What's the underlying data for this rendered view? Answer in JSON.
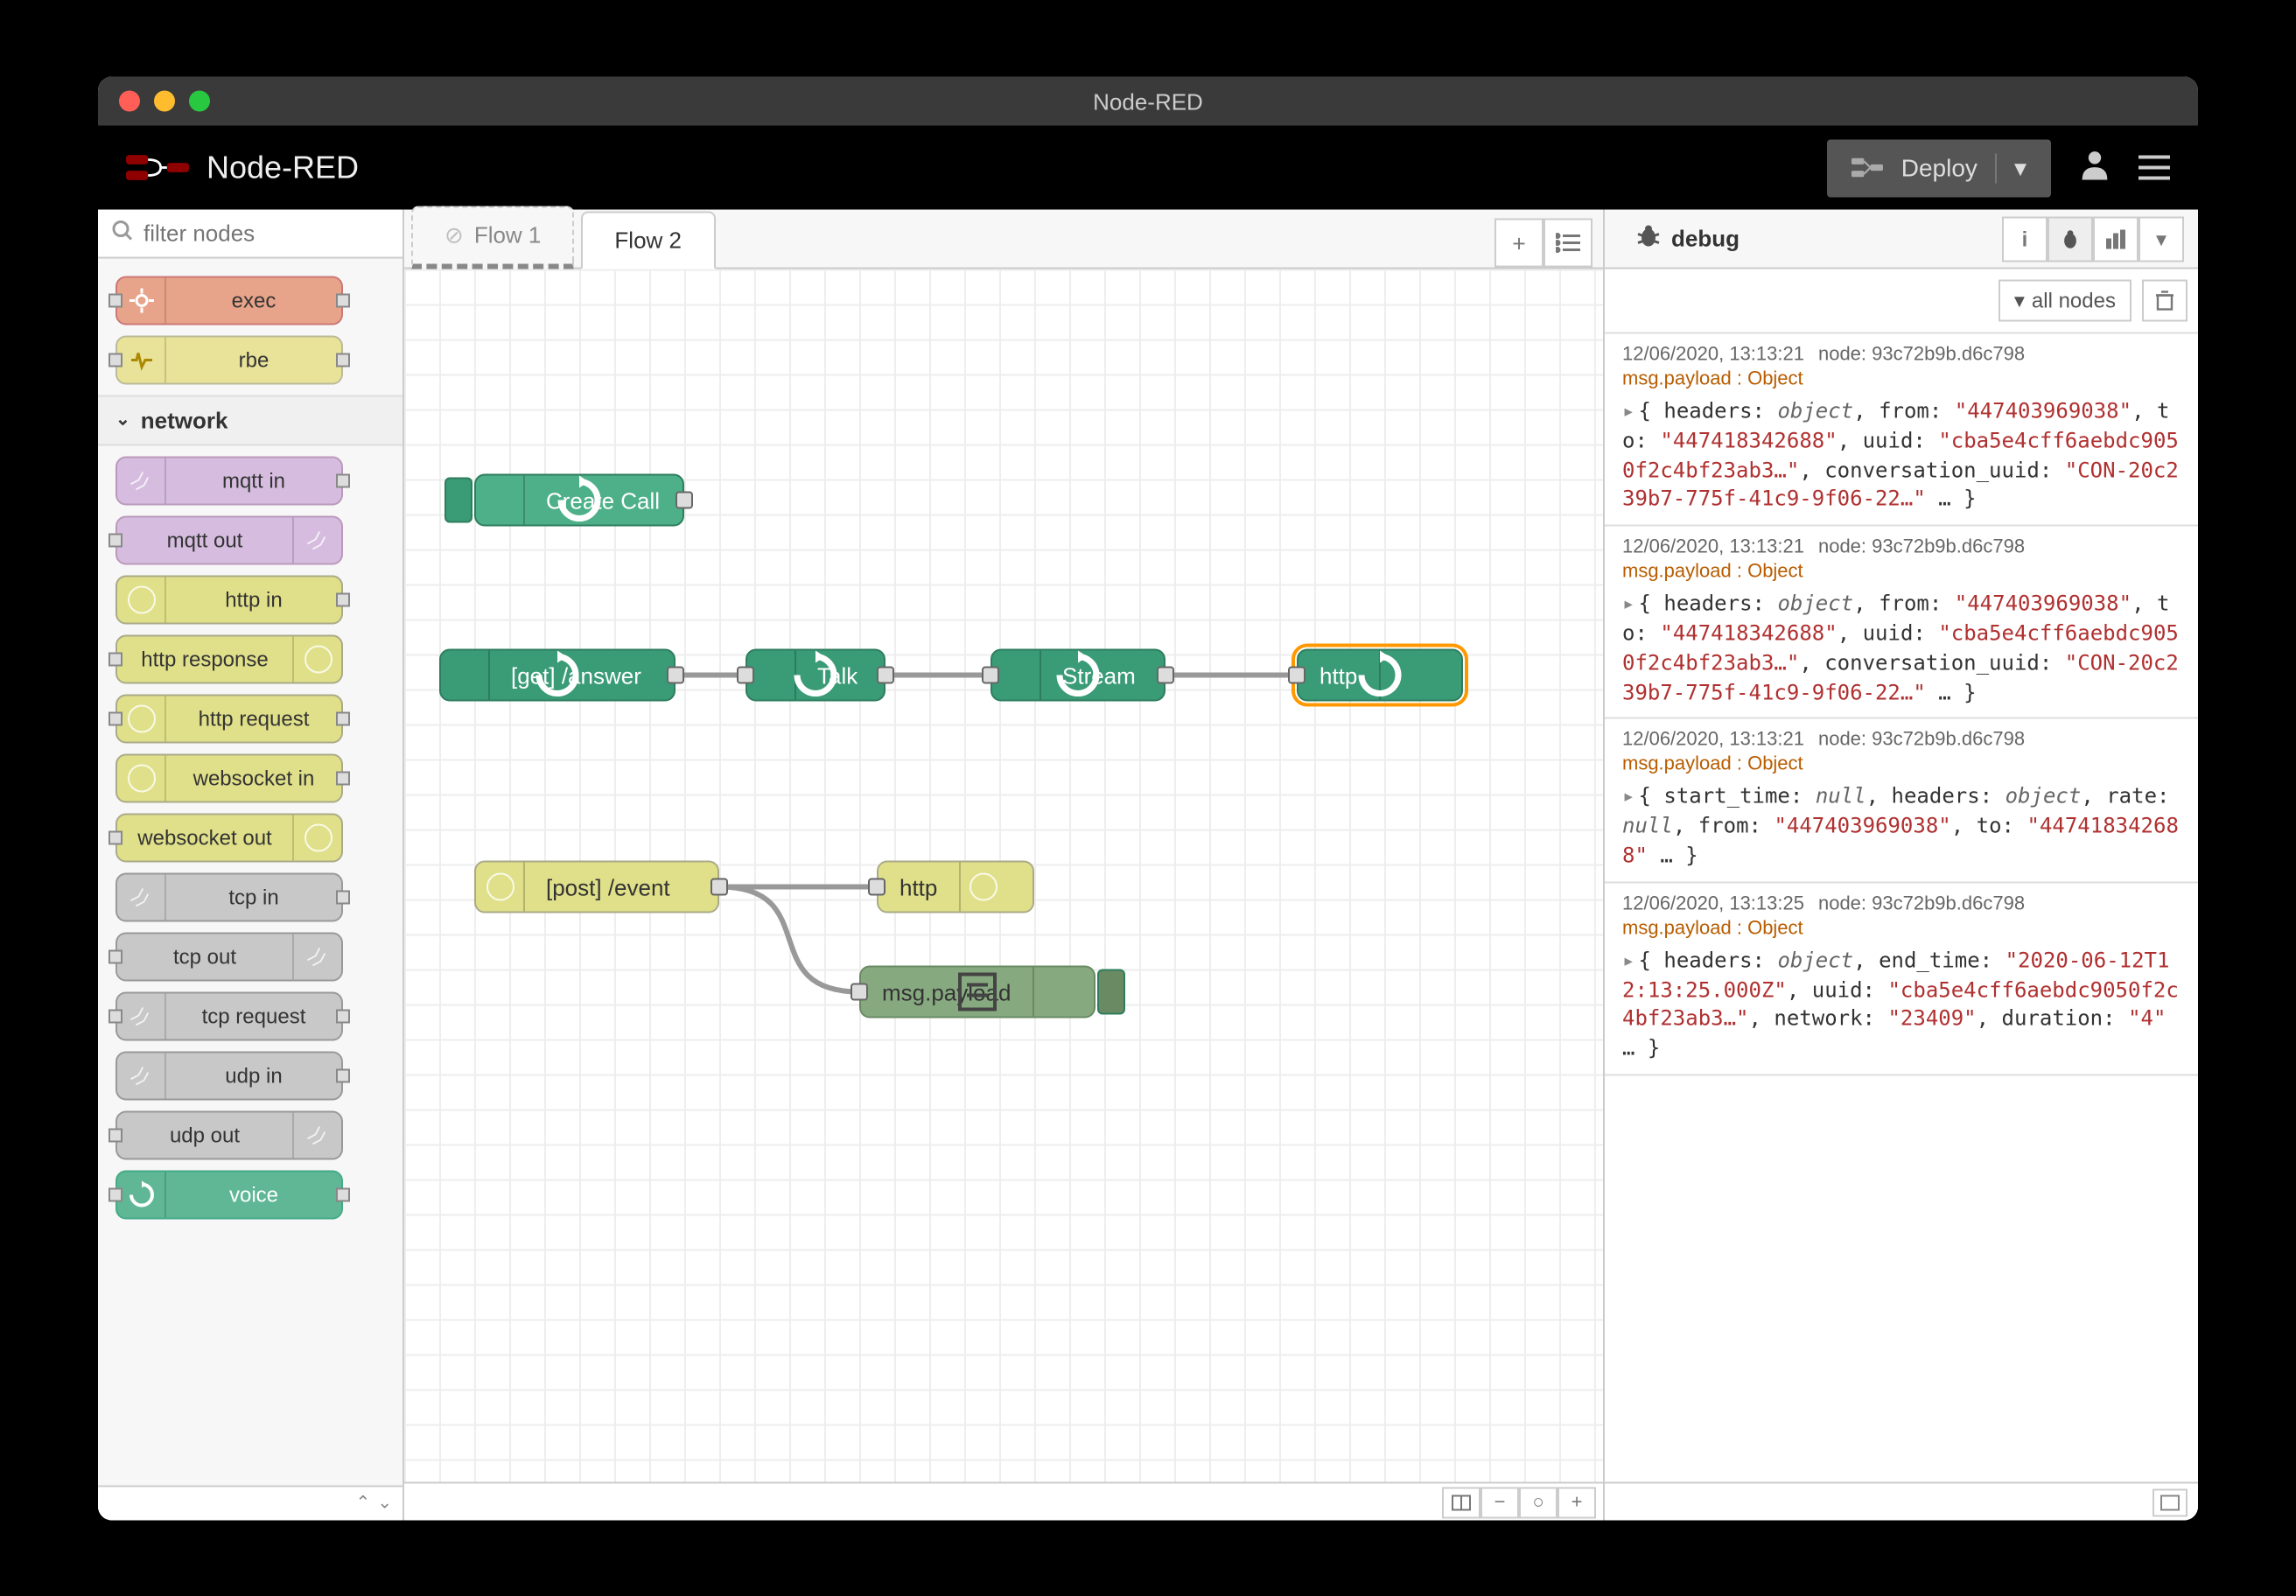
{
  "window": {
    "title": "Node-RED"
  },
  "header": {
    "app_name": "Node-RED",
    "deploy_label": "Deploy"
  },
  "palette": {
    "filter_placeholder": "filter nodes",
    "nodes_top": [
      {
        "label": "exec",
        "cls": "pn-orange",
        "icon": "gear",
        "in": true,
        "out": true
      },
      {
        "label": "rbe",
        "cls": "pn-yellow",
        "icon": "pulse",
        "in": true,
        "out": true
      }
    ],
    "category": "network",
    "nodes_network": [
      {
        "label": "mqtt in",
        "cls": "pn-purple",
        "icon": "signal",
        "iconSide": "left",
        "in": false,
        "out": true
      },
      {
        "label": "mqtt out",
        "cls": "pn-purple",
        "icon": "signal",
        "iconSide": "right",
        "in": true,
        "out": false
      },
      {
        "label": "http in",
        "cls": "pn-olive",
        "icon": "globe",
        "iconSide": "left",
        "in": false,
        "out": true
      },
      {
        "label": "http response",
        "cls": "pn-olive",
        "icon": "globe",
        "iconSide": "right",
        "in": true,
        "out": false
      },
      {
        "label": "http request",
        "cls": "pn-olive",
        "icon": "globe",
        "iconSide": "left",
        "in": true,
        "out": true
      },
      {
        "label": "websocket in",
        "cls": "pn-olive",
        "icon": "globe",
        "iconSide": "left",
        "in": false,
        "out": true
      },
      {
        "label": "websocket out",
        "cls": "pn-olive",
        "icon": "globe",
        "iconSide": "right",
        "in": true,
        "out": false
      },
      {
        "label": "tcp in",
        "cls": "pn-grey",
        "icon": "signal",
        "iconSide": "left",
        "in": false,
        "out": true
      },
      {
        "label": "tcp out",
        "cls": "pn-grey",
        "icon": "signal",
        "iconSide": "right",
        "in": true,
        "out": false
      },
      {
        "label": "tcp request",
        "cls": "pn-grey",
        "icon": "signal",
        "iconSide": "left",
        "in": true,
        "out": true
      },
      {
        "label": "udp in",
        "cls": "pn-grey",
        "icon": "signal",
        "iconSide": "left",
        "in": false,
        "out": true
      },
      {
        "label": "udp out",
        "cls": "pn-grey",
        "icon": "signal",
        "iconSide": "right",
        "in": true,
        "out": false
      },
      {
        "label": "voice",
        "cls": "pn-teal",
        "icon": "cycle",
        "iconSide": "left",
        "in": true,
        "out": true
      }
    ]
  },
  "tabs": [
    {
      "label": "Flow 1",
      "state": "dashed"
    },
    {
      "label": "Flow 2",
      "state": "active"
    }
  ],
  "flow_nodes": {
    "create_call": "Create Call",
    "get_answer": "[get] /answer",
    "talk": "Talk",
    "stream": "Stream",
    "http": "http",
    "post_event": "[post] /event",
    "http2": "http",
    "msg_payload": "msg.payload"
  },
  "sidebar": {
    "tab_label": "debug",
    "filter_label": "all nodes"
  },
  "debug": [
    {
      "ts": "12/06/2020, 13:13:21",
      "node": "node: 93c72b9b.d6c798",
      "topic": "msg.payload : Object",
      "body_html": "<span class='tri'>▸</span>{ <span class='k-key'>headers:</span> <span class='k-obj'>object</span>, <span class='k-key'>from:</span> <span class='k-str'>\"447403969038\"</span>, <span class='k-key'>to:</span> <span class='k-str'>\"447418342688\"</span>, <span class='k-key'>uuid:</span> <span class='k-str'>\"cba5e4cff6aebdc9050f2c4bf23ab3…\"</span>, <span class='k-key'>conversation_uuid:</span> <span class='k-str'>\"CON-20c239b7-775f-41c9-9f06-22…\"</span> … }"
    },
    {
      "ts": "12/06/2020, 13:13:21",
      "node": "node: 93c72b9b.d6c798",
      "topic": "msg.payload : Object",
      "body_html": "<span class='tri'>▸</span>{ <span class='k-key'>headers:</span> <span class='k-obj'>object</span>, <span class='k-key'>from:</span> <span class='k-str'>\"447403969038\"</span>, <span class='k-key'>to:</span> <span class='k-str'>\"447418342688\"</span>, <span class='k-key'>uuid:</span> <span class='k-str'>\"cba5e4cff6aebdc9050f2c4bf23ab3…\"</span>, <span class='k-key'>conversation_uuid:</span> <span class='k-str'>\"CON-20c239b7-775f-41c9-9f06-22…\"</span> … }"
    },
    {
      "ts": "12/06/2020, 13:13:21",
      "node": "node: 93c72b9b.d6c798",
      "topic": "msg.payload : Object",
      "body_html": "<span class='tri'>▸</span>{ <span class='k-key'>start_time:</span> <span class='k-null'>null</span>, <span class='k-key'>headers:</span> <span class='k-obj'>object</span>, <span class='k-key'>rate:</span> <span class='k-null'>null</span>, <span class='k-key'>from:</span> <span class='k-str'>\"447403969038\"</span>, <span class='k-key'>to:</span> <span class='k-str'>\"447418342688\"</span> … }"
    },
    {
      "ts": "12/06/2020, 13:13:25",
      "node": "node: 93c72b9b.d6c798",
      "topic": "msg.payload : Object",
      "body_html": "<span class='tri'>▸</span>{ <span class='k-key'>headers:</span> <span class='k-obj'>object</span>, <span class='k-key'>end_time:</span> <span class='k-str'>\"2020-06-12T12:13:25.000Z\"</span>, <span class='k-key'>uuid:</span> <span class='k-str'>\"cba5e4cff6aebdc9050f2c4bf23ab3…\"</span>, <span class='k-key'>network:</span> <span class='k-str'>\"23409\"</span>, <span class='k-key'>duration:</span> <span class='k-str'>\"4\"</span> … }"
    }
  ]
}
